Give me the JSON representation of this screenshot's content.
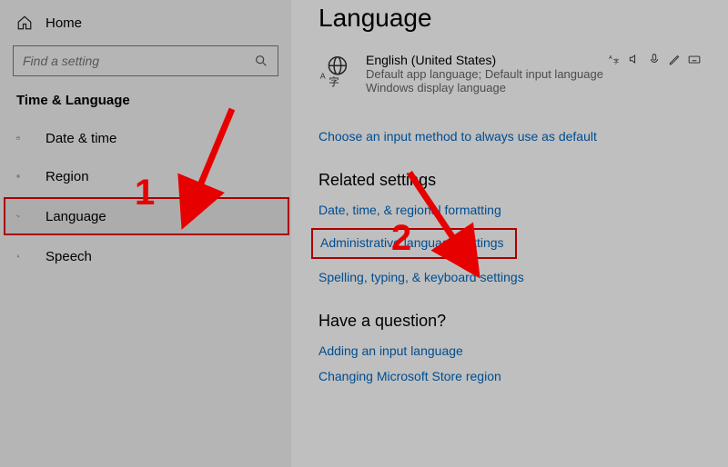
{
  "sidebar": {
    "home_label": "Home",
    "search_placeholder": "Find a setting",
    "section_title": "Time & Language",
    "items": [
      {
        "label": "Date & time"
      },
      {
        "label": "Region"
      },
      {
        "label": "Language"
      },
      {
        "label": "Speech"
      }
    ]
  },
  "main": {
    "title": "Language",
    "current_language": {
      "name": "English (United States)",
      "line2": "Default app language; Default input language",
      "line3": "Windows display language"
    },
    "input_method_link": "Choose an input method to always use as default",
    "related_settings_heading": "Related settings",
    "related_links": [
      "Date, time, & regional formatting",
      "Administrative language settings",
      "Spelling, typing, & keyboard settings"
    ],
    "question_heading": "Have a question?",
    "question_links": [
      "Adding an input language",
      "Changing Microsoft Store region"
    ]
  },
  "annotations": {
    "step1": "1",
    "step2": "2",
    "color": "#e60000"
  }
}
